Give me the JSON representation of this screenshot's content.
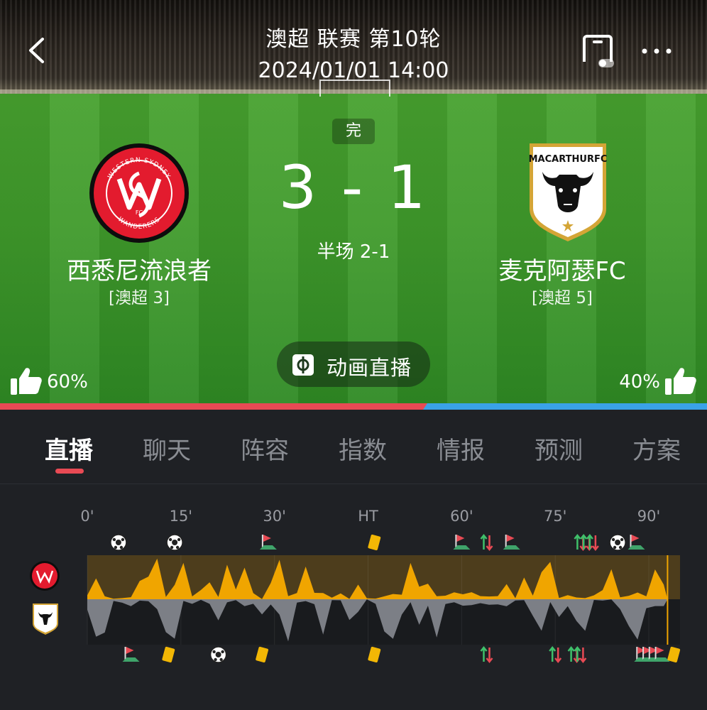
{
  "header": {
    "title": "澳超 联赛 第10轮",
    "datetime": "2024/01/01 14:00"
  },
  "match": {
    "status": "完",
    "score": "3 - 1",
    "half_score": "半场 2-1",
    "animation_button_label": "动画直播"
  },
  "home": {
    "name": "西悉尼流浪者",
    "rank": "[澳超 3]",
    "logo_text_top": "WESTERN SYDNEY",
    "logo_text_bottom": "WANDERERS",
    "logo_monogram": "FC",
    "support_pct": "60%",
    "color": "#e84a54"
  },
  "away": {
    "name": "麦克阿瑟FC",
    "rank": "[澳超 5]",
    "logo_text": "MACARTHURFC",
    "support_pct": "40%",
    "color": "#3aa2e8"
  },
  "tabs": [
    {
      "label": "直播",
      "active": true
    },
    {
      "label": "聊天",
      "active": false
    },
    {
      "label": "阵容",
      "active": false
    },
    {
      "label": "指数",
      "active": false
    },
    {
      "label": "情报",
      "active": false
    },
    {
      "label": "预测",
      "active": false
    },
    {
      "label": "方案",
      "active": false
    }
  ],
  "timeline": {
    "ticks": [
      "0'",
      "15'",
      "30'",
      "HT",
      "60'",
      "75'",
      "90'"
    ],
    "home_events": [
      {
        "type": "goal",
        "minute": 5
      },
      {
        "type": "goal",
        "minute": 14
      },
      {
        "type": "corner",
        "minute": 29
      },
      {
        "type": "yellow_card",
        "minute": 46
      },
      {
        "type": "corner",
        "minute": 60
      },
      {
        "type": "substitution",
        "minute": 64
      },
      {
        "type": "corner",
        "minute": 68
      },
      {
        "type": "substitution",
        "minute": 79
      },
      {
        "type": "substitution",
        "minute": 80
      },
      {
        "type": "substitution",
        "minute": 81
      },
      {
        "type": "goal",
        "minute": 85
      },
      {
        "type": "corner",
        "minute": 88
      }
    ],
    "away_events": [
      {
        "type": "corner",
        "minute": 7
      },
      {
        "type": "yellow_card",
        "minute": 13
      },
      {
        "type": "goal",
        "minute": 21
      },
      {
        "type": "yellow_card",
        "minute": 28
      },
      {
        "type": "yellow_card",
        "minute": 46
      },
      {
        "type": "substitution",
        "minute": 64
      },
      {
        "type": "substitution",
        "minute": 75
      },
      {
        "type": "substitution",
        "minute": 78
      },
      {
        "type": "substitution",
        "minute": 79
      },
      {
        "type": "corner",
        "minute": 89
      },
      {
        "type": "corner",
        "minute": 90
      },
      {
        "type": "corner",
        "minute": 91
      },
      {
        "type": "corner",
        "minute": 92
      },
      {
        "type": "yellow_card",
        "minute": 94
      }
    ],
    "colors": {
      "home_area": "#f0a500",
      "away_area": "#7c7f86"
    }
  }
}
